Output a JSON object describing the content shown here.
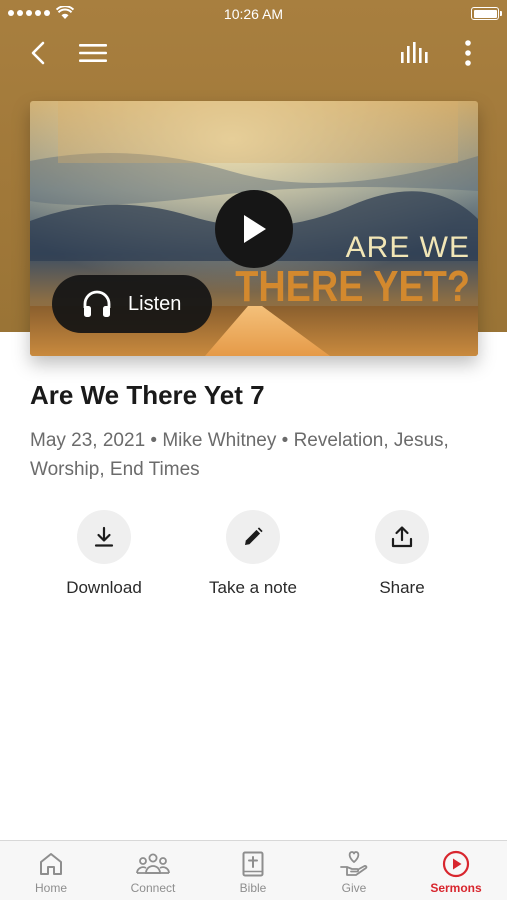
{
  "status_bar": {
    "time": "10:26 AM"
  },
  "artwork": {
    "title_line1": "ARE WE",
    "title_line2": "THERE YET?"
  },
  "player": {
    "listen_label": "Listen"
  },
  "sermon": {
    "title": "Are We There Yet 7",
    "meta": "May 23, 2021 • Mike Whitney • Revelation, Jesus, Worship, End Times"
  },
  "actions": [
    {
      "label": "Download",
      "icon": "download-icon"
    },
    {
      "label": "Take a note",
      "icon": "pencil-icon"
    },
    {
      "label": "Share",
      "icon": "share-icon"
    }
  ],
  "tabs": [
    {
      "label": "Home",
      "icon": "home-icon"
    },
    {
      "label": "Connect",
      "icon": "people-icon"
    },
    {
      "label": "Bible",
      "icon": "bible-icon"
    },
    {
      "label": "Give",
      "icon": "give-hand-icon"
    },
    {
      "label": "Sermons",
      "icon": "play-circle-icon",
      "active": true
    }
  ],
  "colors": {
    "header_band": "#a07839",
    "accent": "#d8262e",
    "tab_inactive": "#8e8e8e"
  }
}
